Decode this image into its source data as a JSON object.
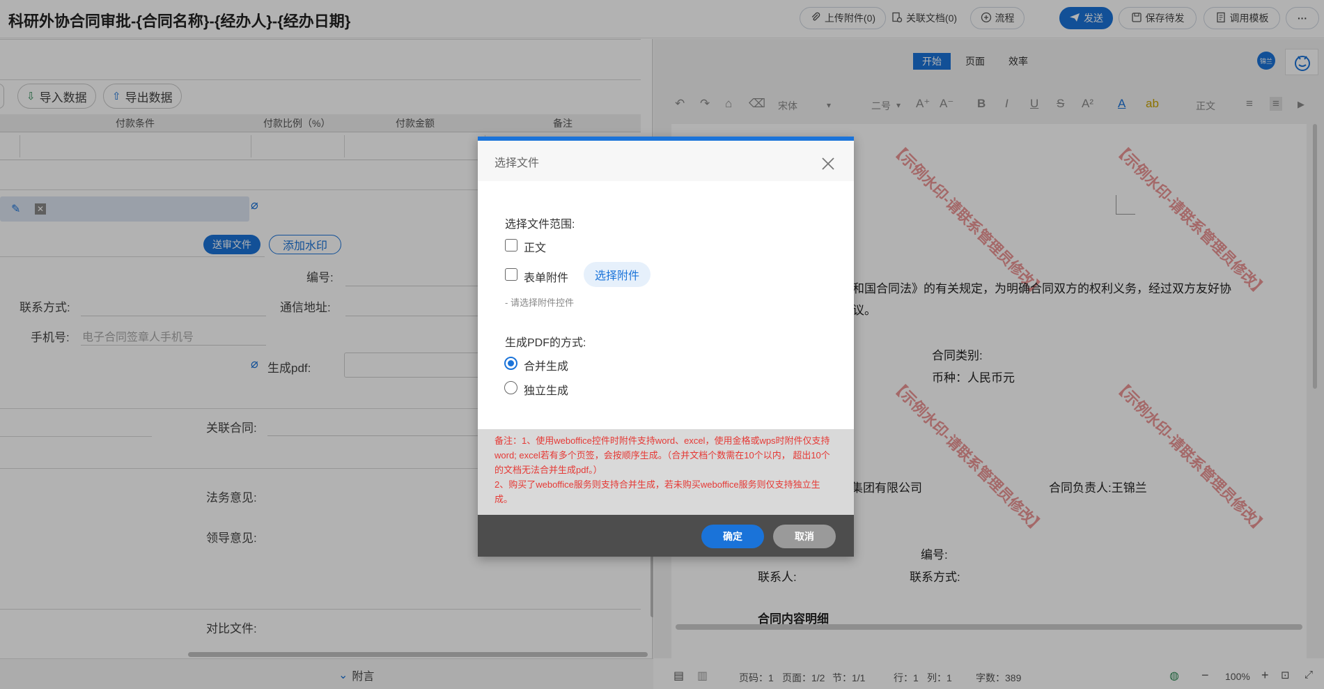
{
  "header": {
    "title": "科研外协合同审批-{合同名称}-{经办人}-{经办日期}",
    "upload_attachment": "上传附件(0)",
    "related_docs": "关联文档(0)",
    "flow": "流程",
    "send": "发送",
    "save_pending": "保存待发",
    "use_template": "调用模板",
    "more": "···"
  },
  "form": {
    "import_data": "导入数据",
    "export_data": "导出数据",
    "table_headers": [
      "付款条件",
      "付款比例（%）",
      "付款金额",
      "备注"
    ],
    "send_review_file": "送审文件",
    "add_watermark": "添加水印",
    "number_label": "编号:",
    "contact_label": "联系方式:",
    "address_label": "通信地址:",
    "mobile_label": "手机号:",
    "mobile_placeholder": "电子合同签章人手机号",
    "generate_pdf_label": "生成pdf:",
    "related_contract_label": "关联合同:",
    "legal_opinion_label": "法务意见:",
    "leader_opinion_label": "领导意见:",
    "compare_file_label": "对比文件:",
    "attachment_toggle": "附言"
  },
  "doc": {
    "tabs": [
      "开始",
      "页面",
      "效率"
    ],
    "avatar_text": "锦兰",
    "font_name": "宋体",
    "font_size": "二号",
    "style_name": "正文",
    "watermark": "【示例水印-请联系管理员修改】",
    "lines": {
      "l1": "和国合同法》的有关规定，为明确合同双方的权利义务，经过双方友好协",
      "l2": "议。",
      "contract_type": "合同类别:",
      "currency": "币种：人民币元",
      "company": "集团有限公司",
      "contract_owner": "合同负责人:王锦兰",
      "number": "编号:",
      "contact_person": "联系人:",
      "contact_method": "联系方式:",
      "detail_heading": "合同内容明细"
    },
    "status": {
      "page_code": "页码：1",
      "page": "页面：1/2",
      "section": "节：1/1",
      "row": "行：1",
      "col": "列：1",
      "word_count": "字数：389",
      "zoom": "100%"
    }
  },
  "dialog": {
    "title": "选择文件",
    "range_label": "选择文件范围:",
    "option_body": "正文",
    "option_form_attachment": "表单附件",
    "select_attachment_button": "选择附件",
    "hint": "- 请选择附件控件",
    "pdf_mode_label": "生成PDF的方式:",
    "mode_merge": "合并生成",
    "mode_separate": "独立生成",
    "note_line1": "备注：1、使用weboffice控件时附件支持word、excel，使用金格或wps时附件仅支持word; excel若有多个页签，会按顺序生成。（合并文档个数需在10个以内，  超出10个的文档无法合并生成pdf。）",
    "note_line2": "2、购买了weboffice服务则支持合并生成，若未购买weboffice服务则仅支持独立生成。",
    "confirm": "确定",
    "cancel": "取消"
  },
  "colors": {
    "primary": "#1a73d9",
    "note_text": "#e53935",
    "footer_bg": "#4d4d4d",
    "cancel_bg": "#9a9a9a"
  }
}
